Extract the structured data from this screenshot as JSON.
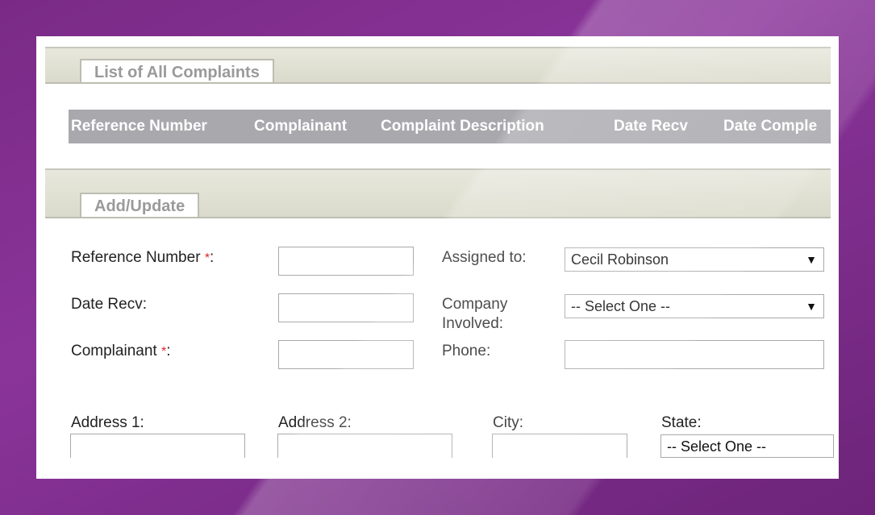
{
  "list_section": {
    "tab_label": "List of All Complaints",
    "columns": [
      "Reference Number",
      "Complainant",
      "Complaint Description",
      "Date Recv",
      "Date Comple"
    ]
  },
  "form_section": {
    "tab_label": "Add/Update",
    "required_mark": "*",
    "reference_number": {
      "label": "Reference Number",
      "suffix": ":",
      "value": ""
    },
    "date_recv": {
      "label": "Date Recv:",
      "value": ""
    },
    "complainant": {
      "label": "Complainant",
      "suffix": ":",
      "value": ""
    },
    "assigned_to": {
      "label": "Assigned to:",
      "selected": "Cecil Robinson"
    },
    "company_involved": {
      "label_line1": "Company",
      "label_line2": "Involved:",
      "selected": "-- Select One --"
    },
    "phone": {
      "label": "Phone:",
      "value": ""
    },
    "address1": {
      "label": "Address 1:",
      "value": ""
    },
    "address2": {
      "label": "Address 2:",
      "value": ""
    },
    "city": {
      "label": "City:",
      "value": ""
    },
    "state": {
      "label": "State:",
      "selected": "-- Select One --"
    }
  },
  "colors": {
    "background": "#7a2a86",
    "header_bar": "#a8a8ad",
    "band": "#dadacb",
    "required": "#e0262b"
  },
  "icons": {
    "dropdown": "triangle-down-icon"
  }
}
